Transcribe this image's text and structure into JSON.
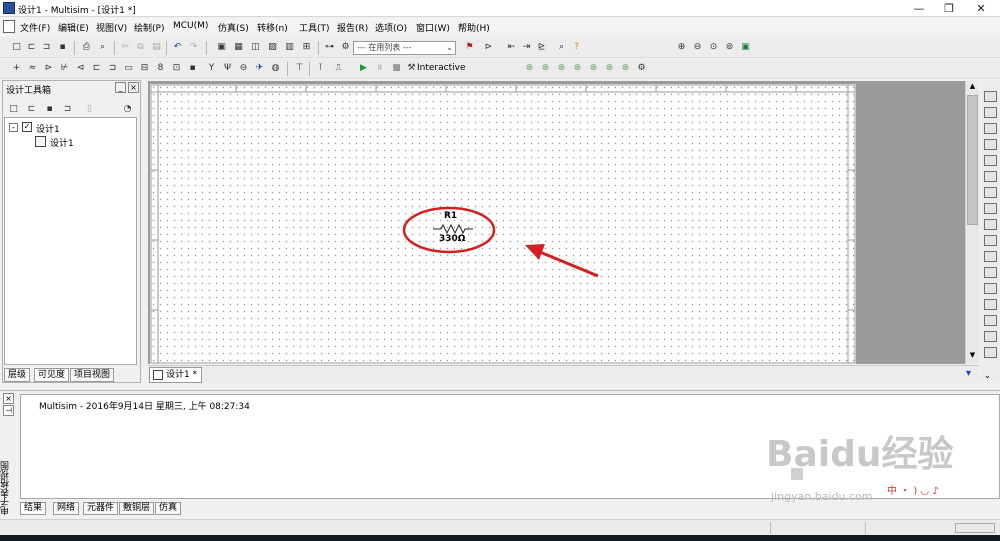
{
  "window": {
    "title": "设计1 - Multisim - [设计1 *]"
  },
  "menu": [
    "文件(F)",
    "编辑(E)",
    "视图(V)",
    "绘制(P)",
    "MCU(M)",
    "仿真(S)",
    "转移(n)",
    "工具(T)",
    "报告(R)",
    "选项(O)",
    "窗口(W)",
    "帮助(H)"
  ],
  "toolbar": {
    "in_use_list": "--- 在用列表 ---",
    "interactive_label": "Interactive"
  },
  "left_panel": {
    "title": "设计工具箱",
    "tree_root": "设计1",
    "tree_child": "设计1",
    "tabs": [
      "层级",
      "可见度",
      "项目视图"
    ]
  },
  "schematic": {
    "component_ref": "R1",
    "component_value": "330Ω"
  },
  "document_tab": "设计1 *",
  "output": {
    "line": "Multisim  -  2016年9月14日 星期三, 上午 08:27:34",
    "side_label": "电子表格视图",
    "tabs": [
      "结果",
      "网络",
      "元器件",
      "敷铜层",
      "仿真"
    ]
  },
  "watermark": {
    "brand": "Baidu经验",
    "url": "jingyan.baidu.com"
  },
  "colors": {
    "annotation": "#d32020",
    "title_icon": "#2a4fa0"
  }
}
